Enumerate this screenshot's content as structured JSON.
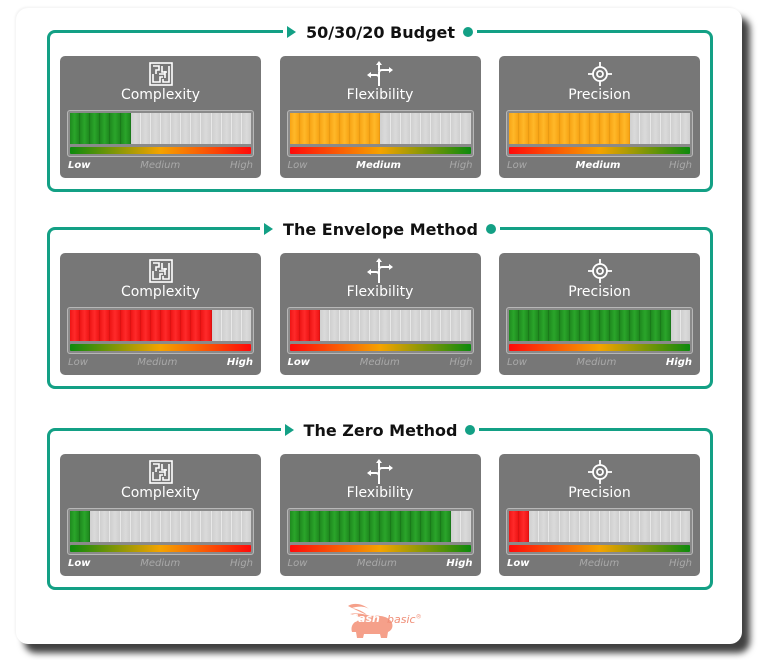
{
  "sections": [
    {
      "title": "50/30/20 Budget",
      "panels": [
        {
          "label": "Complexity",
          "icon": "maze-icon",
          "filled_segments": 6,
          "total_segments": 18,
          "fill_color": "green",
          "scale": "green-to-red",
          "level": "Low"
        },
        {
          "label": "Flexibility",
          "icon": "crossroads-arrows-icon",
          "filled_segments": 9,
          "total_segments": 18,
          "fill_color": "orange",
          "scale": "red-to-green",
          "level": "Medium"
        },
        {
          "label": "Precision",
          "icon": "target-crosshair-icon",
          "filled_segments": 12,
          "total_segments": 18,
          "fill_color": "orange",
          "scale": "red-to-green",
          "level": "Medium"
        }
      ]
    },
    {
      "title": "The Envelope Method",
      "panels": [
        {
          "label": "Complexity",
          "icon": "maze-icon",
          "filled_segments": 14,
          "total_segments": 18,
          "fill_color": "red",
          "scale": "green-to-red",
          "level": "High"
        },
        {
          "label": "Flexibility",
          "icon": "crossroads-arrows-icon",
          "filled_segments": 3,
          "total_segments": 18,
          "fill_color": "red",
          "scale": "red-to-green",
          "level": "Low"
        },
        {
          "label": "Precision",
          "icon": "target-crosshair-icon",
          "filled_segments": 16,
          "total_segments": 18,
          "fill_color": "green",
          "scale": "red-to-green",
          "level": "High"
        }
      ]
    },
    {
      "title": "The Zero Method",
      "panels": [
        {
          "label": "Complexity",
          "icon": "maze-icon",
          "filled_segments": 2,
          "total_segments": 18,
          "fill_color": "green",
          "scale": "green-to-red",
          "level": "Low"
        },
        {
          "label": "Flexibility",
          "icon": "crossroads-arrows-icon",
          "filled_segments": 16,
          "total_segments": 18,
          "fill_color": "green",
          "scale": "red-to-green",
          "level": "High"
        },
        {
          "label": "Precision",
          "icon": "target-crosshair-icon",
          "filled_segments": 2,
          "total_segments": 18,
          "fill_color": "red",
          "scale": "red-to-green",
          "level": "Low"
        }
      ]
    }
  ],
  "level_labels": [
    "Low",
    "Medium",
    "High"
  ],
  "colors": {
    "accent": "#13a085",
    "panel": "#777777",
    "green": "#2aa52a",
    "orange": "#ffb020",
    "red": "#ff2020",
    "logo": "#f5a08a"
  },
  "logo": {
    "cash": "Cash",
    "basic": "basic",
    "mark": "®"
  }
}
